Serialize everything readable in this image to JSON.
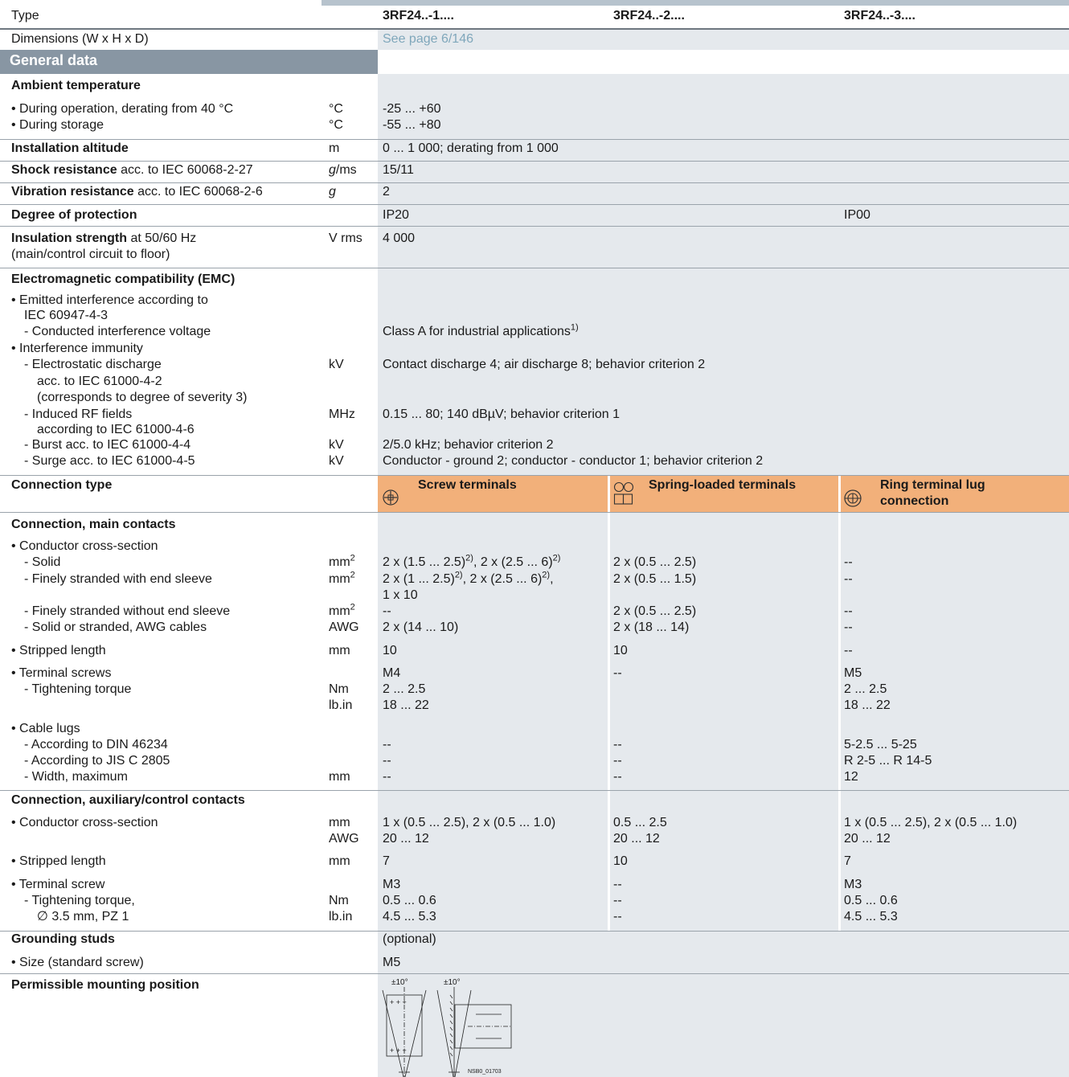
{
  "header": {
    "type_label": "Type",
    "type_1": "3RF24..-1....",
    "type_2": "3RF24..-2....",
    "type_3": "3RF24..-3....",
    "dimensions_label": "Dimensions (W x H x D)",
    "dimensions_value": "See page 6/146"
  },
  "section": {
    "general_data": "General data"
  },
  "ambient": {
    "title": "Ambient temperature",
    "operation_label": "• During operation, derating from 40 °C",
    "operation_unit": "°C",
    "operation_value": "-25 ... +60",
    "storage_label": "• During storage",
    "storage_unit": "°C",
    "storage_value": "-55 ... +80"
  },
  "altitude": {
    "label": "Installation altitude",
    "unit": "m",
    "value": "0 ... 1 000; derating from 1 000"
  },
  "shock": {
    "label_bold": "Shock resistance",
    "label_rest": " acc. to IEC 60068-2-27",
    "unit_italic": "g",
    "unit_rest": "/ms",
    "value": "15/11"
  },
  "vibration": {
    "label_bold": "Vibration resistance",
    "label_rest": " acc. to IEC 60068-2-6",
    "unit": "g",
    "value": "2"
  },
  "protection": {
    "label": "Degree of protection",
    "value_12": "IP20",
    "value_3": "IP00"
  },
  "insulation": {
    "label_bold": "Insulation strength",
    "label_rest": " at 50/60 Hz",
    "label_line2": "(main/control circuit to floor)",
    "unit": "V rms",
    "value": "4 000"
  },
  "emc": {
    "title": "Electromagnetic compatibility (EMC)",
    "l1": "• Emitted interference according to",
    "l2": "IEC 60947-4-3",
    "l3": "- Conducted interference voltage",
    "v3": "Class A for industrial applications",
    "v3_sup": "1)",
    "l4": "• Interference immunity",
    "l5": "- Electrostatic discharge",
    "u5": "kV",
    "v5": "Contact discharge 4; air discharge 8; behavior criterion 2",
    "l6": "acc. to IEC 61000-4-2",
    "l7": "(corresponds to degree of severity 3)",
    "l8": "- Induced RF fields",
    "u8": "MHz",
    "v8": "0.15 ... 80; 140 dBµV; behavior criterion 1",
    "l9": "according to IEC 61000-4-6",
    "l10": "- Burst acc. to IEC 61000-4-4",
    "u10": "kV",
    "v10": "2/5.0 kHz; behavior criterion 2",
    "l11": "- Surge acc. to IEC 61000-4-5",
    "u11": "kV",
    "v11": "Conductor - ground 2; conductor - conductor 1; behavior criterion 2"
  },
  "connection_type": {
    "label": "Connection type",
    "screw": "Screw terminals",
    "spring": "Spring-loaded terminals",
    "ring_1": "Ring terminal lug",
    "ring_2": "connection",
    "screw_icon": "screw-terminal-icon",
    "spring_icon": "spring-terminal-icon",
    "ring_icon": "ring-terminal-icon"
  },
  "main_contacts": {
    "title": "Connection, main contacts",
    "cs_label": "• Conductor cross-section",
    "solid_label": "- Solid",
    "solid_unit": "mm",
    "solid_unit_sup": "2",
    "solid_c1a": "2 x (1.5 ... 2.5)",
    "solid_c1a_sup": "2)",
    "solid_c1b": ", 2 x (2.5 ... 6)",
    "solid_c1b_sup": "2)",
    "solid_c2": "2 x (0.5 ... 2.5)",
    "solid_c3": "--",
    "fine_label": "- Finely stranded with end sleeve",
    "fine_unit": "mm",
    "fine_unit_sup": "2",
    "fine_c1a": "2 x (1 ... 2.5)",
    "fine_c1a_sup": "2)",
    "fine_c1b": ", 2 x (2.5 ... 6)",
    "fine_c1b_sup": "2)",
    "fine_c1c": ",",
    "fine_c1_line2": "1 x 10",
    "fine_c2": "2 x (0.5 ... 1.5)",
    "fine_c3": "--",
    "fine_wo_label": "- Finely stranded without end sleeve",
    "fine_wo_unit": "mm",
    "fine_wo_unit_sup": "2",
    "fine_wo_c1": "--",
    "fine_wo_c2": "2 x (0.5 ... 2.5)",
    "fine_wo_c3": "--",
    "awg_label": "- Solid or stranded, AWG cables",
    "awg_unit": "AWG",
    "awg_c1": "2 x (14 ... 10)",
    "awg_c2": "2 x (18 ... 14)",
    "awg_c3": "--",
    "strip_label": "• Stripped length",
    "strip_unit": "mm",
    "strip_c1": "10",
    "strip_c2": "10",
    "strip_c3": "--",
    "screws_label": "• Terminal screws",
    "screws_c1": "M4",
    "screws_c2": "--",
    "screws_c3": "M5",
    "torque_label": "- Tightening torque",
    "torque_unit1": "Nm",
    "torque_unit2": "lb.in",
    "torque_c1a": "2 ... 2.5",
    "torque_c1b": "18 ... 22",
    "torque_c3a": "2 ... 2.5",
    "torque_c3b": "18 ... 22",
    "lugs_label": "• Cable lugs",
    "din_label": "- According to DIN 46234",
    "din_c1": "--",
    "din_c2": "--",
    "din_c3": "5-2.5 ... 5-25",
    "jis_label": "- According to JIS C 2805",
    "jis_c1": "--",
    "jis_c2": "--",
    "jis_c3": "R 2-5 ... R 14-5",
    "width_label": "- Width, maximum",
    "width_unit": "mm",
    "width_c1": "--",
    "width_c2": "--",
    "width_c3": "12"
  },
  "aux_contacts": {
    "title": "Connection, auxiliary/control contacts",
    "cs_label": "• Conductor cross-section",
    "cs_unit1": "mm",
    "cs_unit2": "AWG",
    "cs_c1a": "1 x (0.5 ... 2.5), 2 x (0.5 ... 1.0)",
    "cs_c1b": "20 ... 12",
    "cs_c2a": "0.5 ... 2.5",
    "cs_c2b": "20 ... 12",
    "cs_c3a": "1 x (0.5 ... 2.5), 2 x (0.5 ... 1.0)",
    "cs_c3b": "20 ... 12",
    "strip_label": "• Stripped length",
    "strip_unit": "mm",
    "strip_c1": "7",
    "strip_c2": "10",
    "strip_c3": "7",
    "screw_label": "• Terminal screw",
    "screw_c1": "M3",
    "screw_c2": "--",
    "screw_c3": "M3",
    "torque_label": "- Tightening torque,",
    "torque_label2": "∅ 3.5 mm, PZ 1",
    "torque_unit1": "Nm",
    "torque_unit2": "lb.in",
    "torque_c1a": "0.5 ... 0.6",
    "torque_c1b": "4.5 ... 5.3",
    "torque_c2a": "--",
    "torque_c2b": "--",
    "torque_c3a": "0.5 ... 0.6",
    "torque_c3b": "4.5 ... 5.3"
  },
  "grounding": {
    "label": "Grounding studs",
    "value": "(optional)",
    "size_label": "• Size (standard screw)",
    "size_value": "M5"
  },
  "mounting": {
    "label": "Permissible mounting position",
    "angle_1": "±10°",
    "angle_2": "±10°",
    "drawing_id": "NSB0_01703"
  },
  "colors": {
    "gray_bg": "#e5e9ed",
    "section_bar": "#8896a3",
    "orange_header": "#f2b07a",
    "link": "#7fa7bb"
  }
}
